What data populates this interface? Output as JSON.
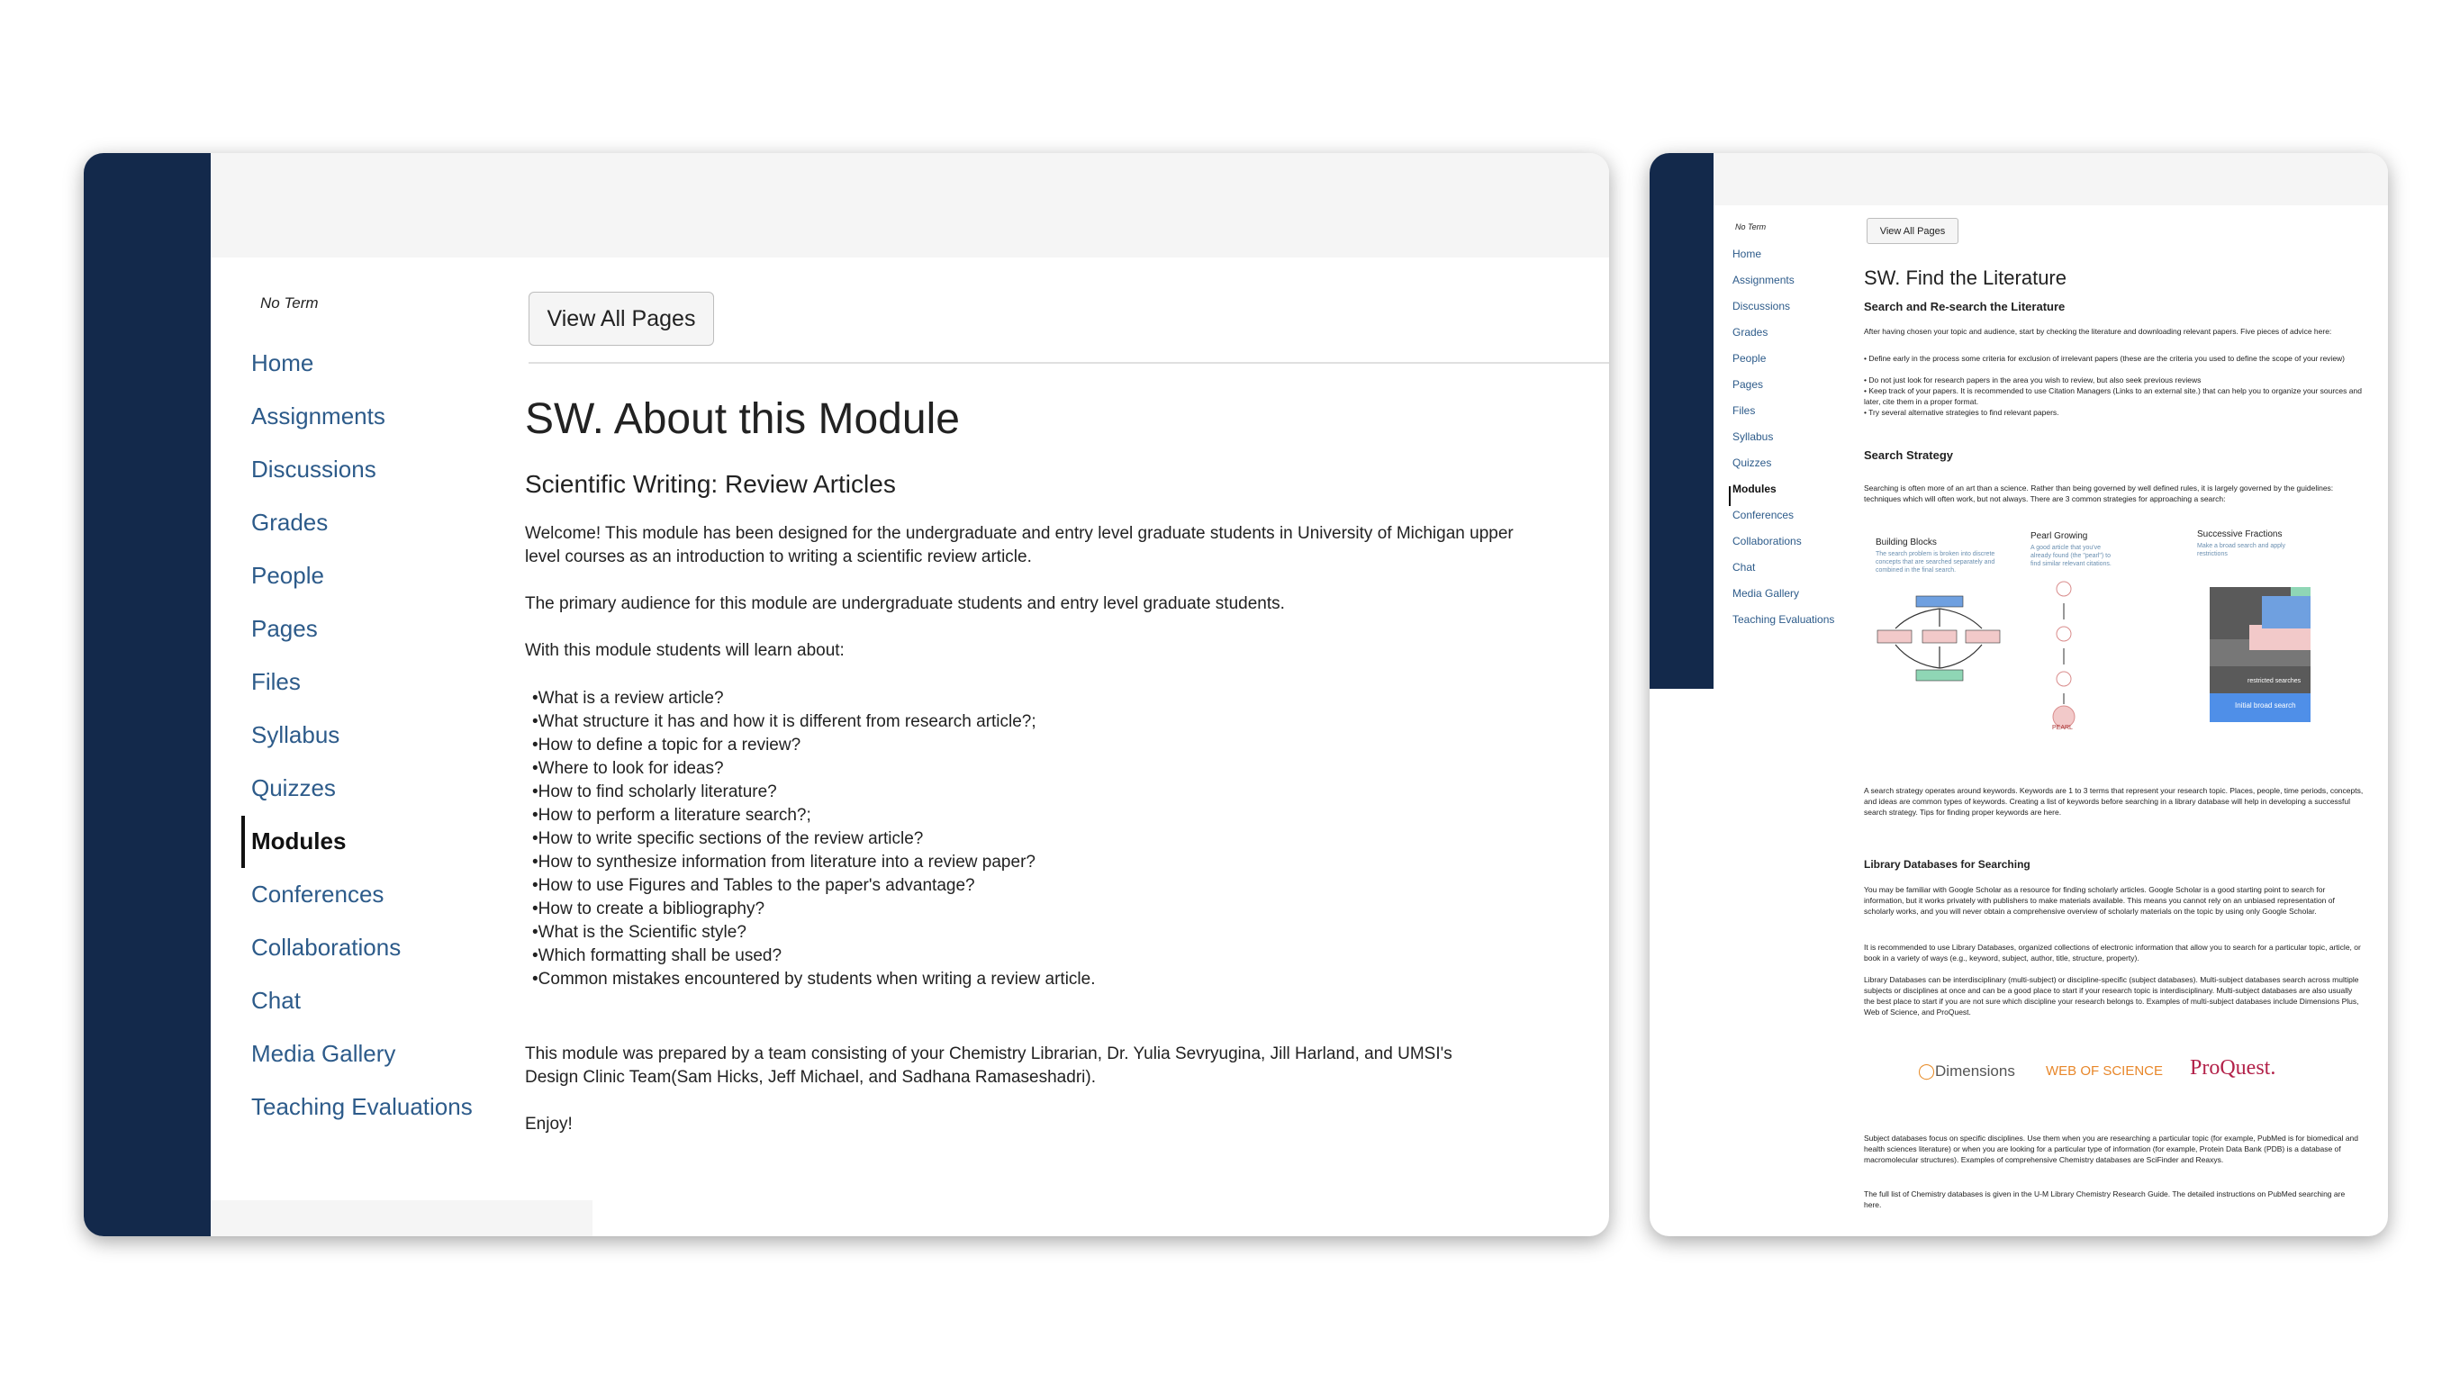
{
  "left": {
    "term": "No Term",
    "nav": [
      "Home",
      "Assignments",
      "Discussions",
      "Grades",
      "People",
      "Pages",
      "Files",
      "Syllabus",
      "Quizzes",
      "Modules",
      "Conferences",
      "Collaborations",
      "Chat",
      "Media Gallery",
      "Teaching Evaluations"
    ],
    "active_nav": "Modules",
    "view_all_pages": "View All Pages",
    "title": "SW. About this Module",
    "subtitle": "Scientific Writing: Review Articles",
    "p1": "Welcome! This module has been designed for the undergraduate and entry level graduate students in University of Michigan upper level courses as an introduction to writing a scientific review article.",
    "p2": "The primary audience for this module are undergraduate students and entry level graduate students.",
    "p3": "With this module students will learn about:",
    "bullets": [
      "What is a review article?",
      "What structure it has and how it is different from research article?;",
      "How to define a topic for a review?",
      "Where to look for ideas?",
      "How to find scholarly literature?",
      "How to perform a literature search?;",
      "How to write specific sections of the review article?",
      "How to synthesize information from literature into a review paper?",
      "How to use Figures and Tables to the paper's advantage?",
      "How to create a bibliography?",
      "What is the Scientific style?",
      "Which formatting shall be used?",
      "Common mistakes encountered by students when writing a review article."
    ],
    "p4": "This module was prepared by a team consisting of your Chemistry Librarian, Dr. Yulia Sevryugina, Jill Harland, and UMSI's Design Clinic Team(Sam Hicks, Jeff Michael, and Sadhana Ramaseshadri).",
    "p5": "Enjoy!"
  },
  "right": {
    "term": "No Term",
    "nav": [
      "Home",
      "Assignments",
      "Discussions",
      "Grades",
      "People",
      "Pages",
      "Files",
      "Syllabus",
      "Quizzes",
      "Modules",
      "Conferences",
      "Collaborations",
      "Chat",
      "Media Gallery",
      "Teaching Evaluations"
    ],
    "active_nav": "Modules",
    "view_all_pages": "View All Pages",
    "title": "SW. Find the Literature",
    "h_search": "Search and Re-search the Literature",
    "intro": "After having chosen your topic and audience, start by checking the literature and downloading relevant papers. Five pieces of advice here:",
    "advice": [
      "• Define early in the process some criteria for exclusion of irrelevant papers (these are the criteria you used to define the scope of your review)",
      "• Do not just look for research papers in the area you wish to review, but also seek previous reviews",
      "• Keep track of your papers. It is recommended to use Citation Managers (Links to an external site.) that can help you to organize your sources and later, cite them in a proper format.",
      "• Try several alternative strategies to find relevant papers."
    ],
    "h_strategy": "Search Strategy",
    "strategy_text": "Searching is often more of an art than a science. Rather than being governed by well defined rules, it is largely governed by the guidelines: techniques which will often work, but not always. There are 3 common strategies for approaching a search:",
    "figure": {
      "building_blocks": "Building Blocks",
      "building_blocks_sub": "The search problem is broken into discrete concepts that are searched separately and combined in the final search.",
      "pearl": "Pearl Growing",
      "pearl_sub": "A good article that you've already found (the \"pearl\") to find similar relevant citations.",
      "fractions": "Successive Fractions",
      "fractions_sub": "Make a broad search and apply restrictions",
      "initial_broad": "Initial broad search",
      "restricted": "restricted searches",
      "pearl_label": "PEARL"
    },
    "keywords_text": "A search strategy operates around keywords. Keywords are 1 to 3 terms that represent your research topic. Places, people, time periods, concepts, and ideas are common types of keywords. Creating a list of keywords before searching in a library database will help in developing a successful search strategy. Tips for finding proper keywords are here.",
    "h_databases": "Library Databases for Searching",
    "db1": "You may be familiar with Google Scholar as a resource for finding scholarly articles. Google Scholar is a good starting point to search for information, but it works privately with publishers to make materials available. This means you cannot rely on an unbiased representation of scholarly works, and you will never obtain a comprehensive overview of scholarly materials on the topic by using only Google Scholar.",
    "db2": "It is recommended to use Library Databases, organized collections of electronic information that allow you to search for a particular topic, article, or book in a variety of ways (e.g., keyword, subject, author, title, structure, property).",
    "db3": "Library Databases can be interdisciplinary (multi-subject) or discipline-specific (subject databases). Multi-subject databases search across multiple subjects or disciplines at once and can be a good place to start if your research topic is interdisciplinary. Multi-subject databases are also usually the best place to start if you are not sure which discipline your research belongs to. Examples of multi-subject databases include Dimensions Plus, Web of Science, and ProQuest.",
    "logos": [
      "Dimensions",
      "WEB OF SCIENCE",
      "ProQuest."
    ],
    "subject_db": "Subject databases focus on specific disciplines. Use them when you are researching a particular topic (for example, PubMed is for biomedical and health sciences literature) or when you are looking for a particular type of information (for example, Protein Data Bank (PDB) is a database of macromolecular structures). Examples of comprehensive Chemistry databases are SciFinder and Reaxys.",
    "full_list": "The full list of Chemistry databases is given in the U-M Library Chemistry Research Guide. The detailed instructions on PubMed searching are here."
  }
}
